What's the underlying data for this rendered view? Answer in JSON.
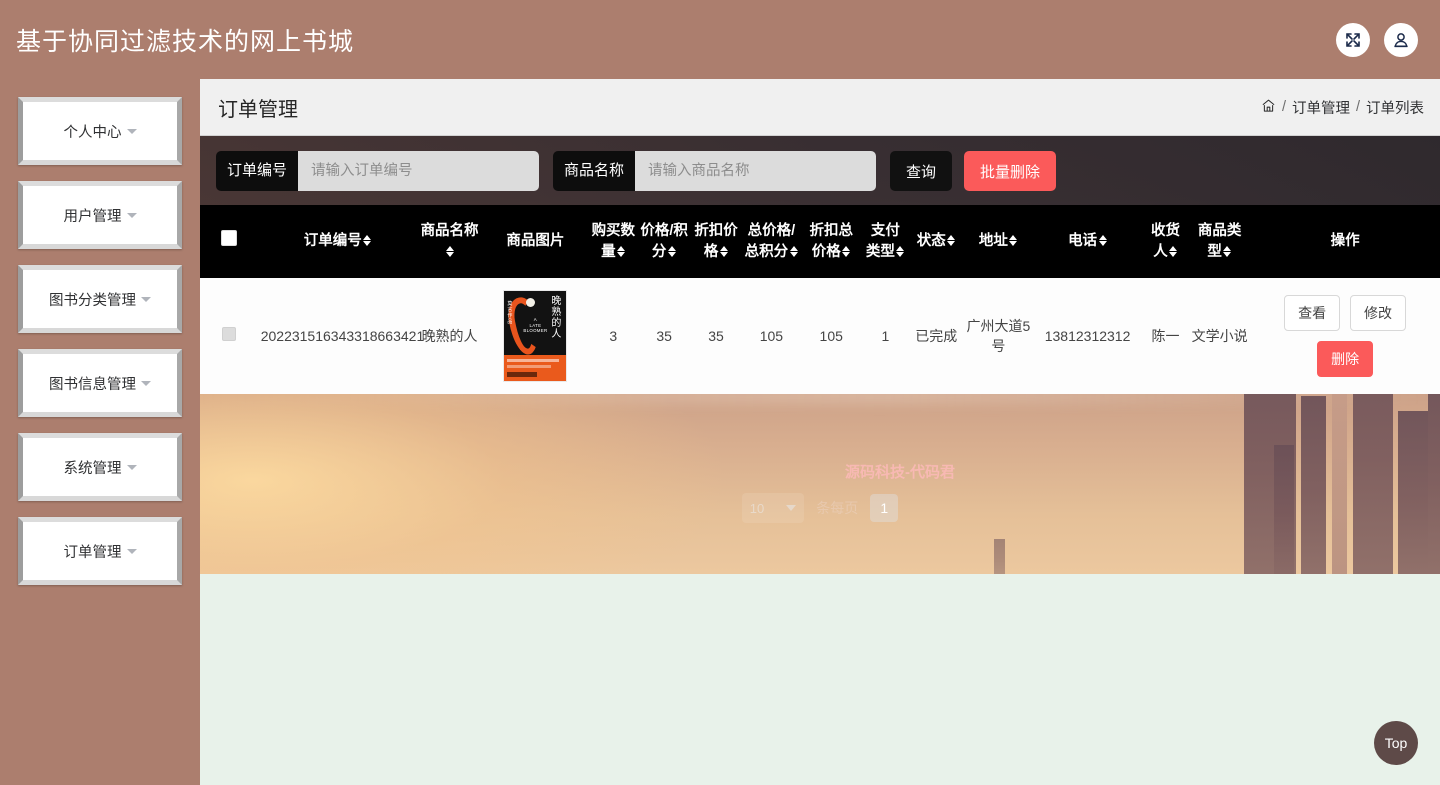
{
  "header": {
    "title": "基于协同过滤技术的网上书城",
    "fullscreen_icon": "fullscreen-icon",
    "user_icon": "user-icon"
  },
  "sidebar": {
    "items": [
      {
        "label": "个人中心"
      },
      {
        "label": "用户管理"
      },
      {
        "label": "图书分类管理"
      },
      {
        "label": "图书信息管理"
      },
      {
        "label": "系统管理"
      },
      {
        "label": "订单管理"
      }
    ]
  },
  "page": {
    "title": "订单管理",
    "breadcrumb": {
      "home_icon": "home-icon",
      "items": [
        "订单管理",
        "订单列表"
      ],
      "separator": "/"
    }
  },
  "toolbar": {
    "order_no_label": "订单编号",
    "order_no_placeholder": "请输入订单编号",
    "order_no_value": "",
    "product_name_label": "商品名称",
    "product_name_placeholder": "请输入商品名称",
    "product_name_value": "",
    "query_label": "查询",
    "batch_delete_label": "批量删除",
    "query_color": "#111111",
    "batch_delete_color": "#fb5a5a"
  },
  "table": {
    "columns": [
      {
        "label": "",
        "sortable": false
      },
      {
        "label": "订单编号",
        "sortable": true
      },
      {
        "label": "商品名称",
        "sortable": true
      },
      {
        "label": "商品图片",
        "sortable": false
      },
      {
        "label": "购买数量",
        "sortable": true
      },
      {
        "label": "价格/积分",
        "sortable": true
      },
      {
        "label": "折扣价格",
        "sortable": true
      },
      {
        "label": "总价格/总积分",
        "sortable": true
      },
      {
        "label": "折扣总价格",
        "sortable": true
      },
      {
        "label": "支付类型",
        "sortable": true
      },
      {
        "label": "状态",
        "sortable": true
      },
      {
        "label": "地址",
        "sortable": true
      },
      {
        "label": "电话",
        "sortable": true
      },
      {
        "label": "收货人",
        "sortable": true
      },
      {
        "label": "商品类型",
        "sortable": true
      },
      {
        "label": "操作",
        "sortable": false
      }
    ],
    "rows": [
      {
        "order_no": "202231516343318663421",
        "product_name": "晚熟的人",
        "product_image_alt": "晚熟的人 A LATE BLOOMER 书籍封面",
        "quantity": "3",
        "price": "35",
        "discount_price": "35",
        "total_price": "105",
        "discount_total": "105",
        "pay_type": "1",
        "status": "已完成",
        "address": "广州大道5号",
        "phone": "13812312312",
        "receiver": "陈一",
        "product_type": "文学小说",
        "actions": {
          "view": "查看",
          "edit": "修改",
          "delete": "删除"
        }
      }
    ],
    "watermark": "源码科技-代码君"
  },
  "pagination": {
    "page_size": "10",
    "page_size_suffix": "条每页",
    "total_text": "条每页",
    "current_page": "1"
  },
  "top_button": {
    "label": "Top"
  }
}
